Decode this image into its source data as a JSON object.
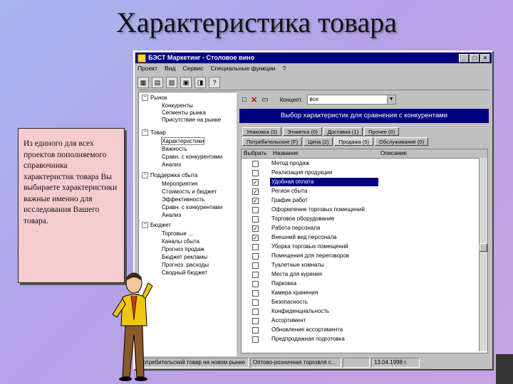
{
  "slide": {
    "title": "Характеристика товара",
    "note": "Из единого для всех проектов пополняемого справочника характеристик товара Вы выбираете характеристики важные именно для исследования Вашего товара."
  },
  "window": {
    "title": "БЭСТ Маркетинг - Столовое вино",
    "menu": [
      "Проект",
      "Вид",
      "Сервис",
      "Специальные функции",
      "?"
    ],
    "tree": [
      {
        "label": "Рынок",
        "leaves": [
          "Конкуренты",
          "Сегменты рынка",
          "Присутствие на рынке"
        ]
      },
      {
        "label": "Товар",
        "leaves": [
          "Характеристики",
          "Важность",
          "Сравн. с конкурентами",
          "Анализ"
        ]
      },
      {
        "label": "Поддержка сбыта",
        "leaves": [
          "Мероприятия",
          "Стоимость и бюджет",
          "Эффективность",
          "Сравн. с конкурентами",
          "Анализ"
        ]
      },
      {
        "label": "Бюджет",
        "leaves": [
          "Торговые ...",
          "Каналы сбыта",
          "Прогноз продаж",
          "Бюджет рекламы",
          "Прогноз. расходы",
          "Сводный бюджет"
        ]
      }
    ],
    "toolbar_right": {
      "label": "Концепт.",
      "combo_value": "все"
    },
    "banner": "Выбор характеристик для сравнения с конкурентами",
    "tabs_row1": [
      "Упаковка (0)",
      "Этикетка (0)",
      "Доставка (1)",
      "Прочее (0)"
    ],
    "tabs_row2": [
      "Потребительские (F)",
      "Цена (2)",
      "Продажа (5)",
      "Обслуживание (0)"
    ],
    "grid_headers": [
      "Выбрать",
      "Название",
      "Описание"
    ],
    "rows": [
      {
        "name": "Метод продаж",
        "checked": false
      },
      {
        "name": "Реализация продукции",
        "checked": false
      },
      {
        "name": "Удобная оплата",
        "checked": true,
        "selected": true
      },
      {
        "name": "Регион сбыта",
        "checked": true
      },
      {
        "name": "График работ",
        "checked": true
      },
      {
        "name": "Оформление торговых помещений",
        "checked": false
      },
      {
        "name": "Торговое оборудование",
        "checked": false
      },
      {
        "name": "Работа персонала",
        "checked": true
      },
      {
        "name": "Внешний вид персонала",
        "checked": true
      },
      {
        "name": "Уборка торговых помещений",
        "checked": false
      },
      {
        "name": "Помещения для переговоров",
        "checked": false
      },
      {
        "name": "Туалетные комнаты",
        "checked": false
      },
      {
        "name": "Места для курения",
        "checked": false
      },
      {
        "name": "Парковка",
        "checked": false
      },
      {
        "name": "Камера хранения",
        "checked": false
      },
      {
        "name": "Безопасность",
        "checked": false
      },
      {
        "name": "Конфиденциальность",
        "checked": false
      },
      {
        "name": "Ассортимент",
        "checked": false
      },
      {
        "name": "Обновление ассортимента",
        "checked": false
      },
      {
        "name": "Предпродажная подготовка",
        "checked": false
      }
    ],
    "status": [
      "Потребительский товар на новом рынке",
      "Оптово-розничная торговля с...",
      "",
      "13.04.1998 г."
    ]
  },
  "colors": {
    "accent": "#000080",
    "note_bg": "#f5ccd0"
  }
}
